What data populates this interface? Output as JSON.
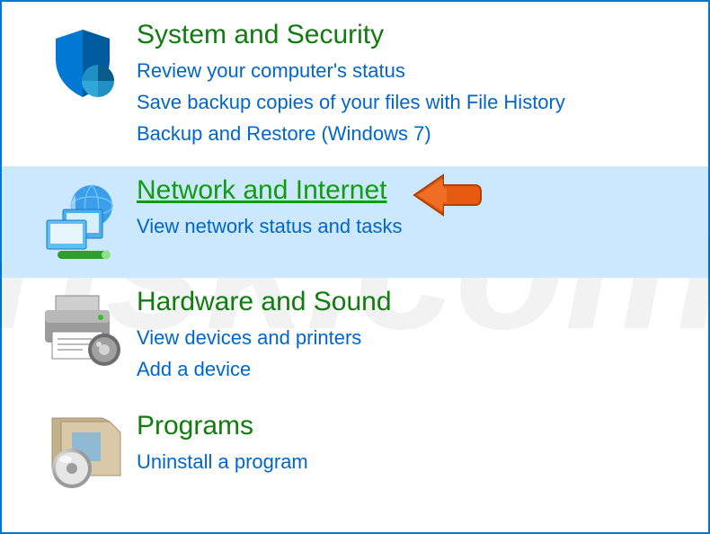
{
  "watermark": "risk.com",
  "categories": [
    {
      "heading": "System and Security",
      "links": [
        "Review your computer's status",
        "Save backup copies of your files with File History",
        "Backup and Restore (Windows 7)"
      ]
    },
    {
      "heading": "Network and Internet",
      "links": [
        "View network status and tasks"
      ],
      "highlighted": true
    },
    {
      "heading": "Hardware and Sound",
      "links": [
        "View devices and printers",
        "Add a device"
      ]
    },
    {
      "heading": "Programs",
      "links": [
        "Uninstall a program"
      ]
    }
  ]
}
